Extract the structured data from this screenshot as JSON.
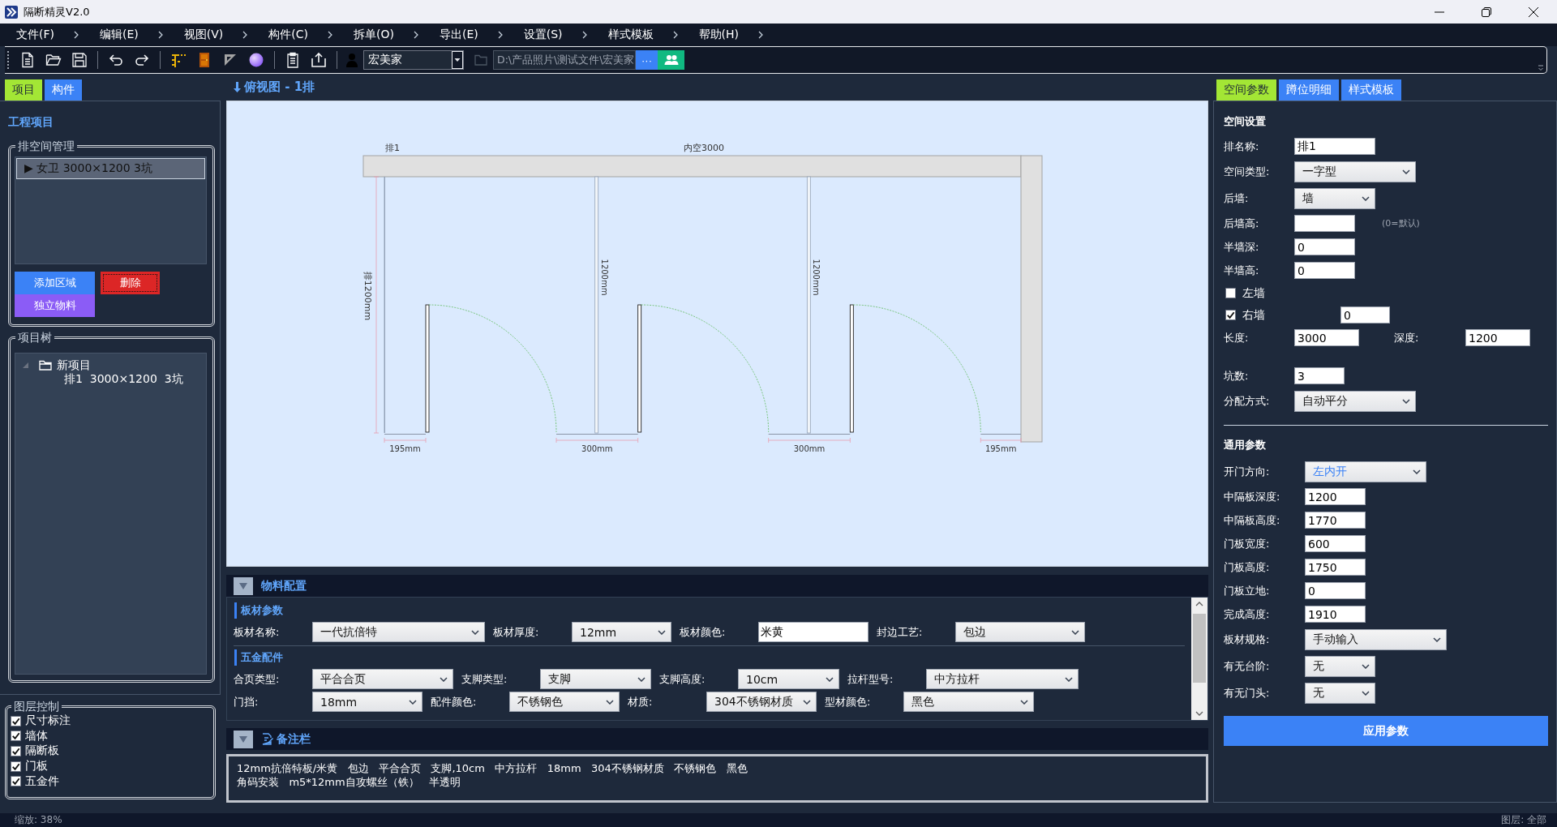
{
  "window": {
    "title": "隔断精灵V2.0"
  },
  "menu": [
    "文件(F)",
    "编辑(E)",
    "视图(V)",
    "构件(C)",
    "拆单(O)",
    "导出(E)",
    "设置(S)",
    "样式模板",
    "帮助(H)"
  ],
  "toolbar": {
    "user": "宏美家",
    "path": "D:\\产品照片\\测试文件\\宏美家",
    "more_button": "···"
  },
  "left_panel": {
    "tabs": [
      {
        "label": "项目",
        "selected": true
      },
      {
        "label": "构件",
        "selected": false
      }
    ],
    "heading": "工程项目",
    "space_group": {
      "title": "排空间管理",
      "items": [
        {
          "label": "▶ 女卫  3000×1200 3坑",
          "selected": true
        }
      ],
      "buttons": [
        {
          "label": "添加区域",
          "kind": "add",
          "focused": false
        },
        {
          "label": "删除",
          "kind": "delete",
          "focused": true
        },
        {
          "label": "独立物料",
          "kind": "material",
          "focused": false
        }
      ]
    },
    "tree_group": {
      "title": "项目树",
      "tree": [
        {
          "label": "新项目",
          "expanded": true,
          "children": [
            {
              "label": "排1  3000×1200  3坑"
            }
          ]
        }
      ]
    },
    "layers": {
      "title": "图层控制",
      "items": [
        {
          "label": "尺寸标注",
          "checked": true
        },
        {
          "label": "墙体",
          "checked": true
        },
        {
          "label": "隔断板",
          "checked": true
        },
        {
          "label": "门板",
          "checked": true
        },
        {
          "label": "五金件",
          "checked": true
        }
      ]
    }
  },
  "view": {
    "title": "俯视图 - 1排",
    "drawing": {
      "row_label": "排1",
      "span_label": "内空3000",
      "depth_label": "排1200mm",
      "partition_labels": [
        "1200mm",
        "1200mm"
      ],
      "gap_labels": [
        "195mm",
        "300mm",
        "300mm",
        "195mm"
      ]
    }
  },
  "materials": {
    "title": "物料配置",
    "sections": [
      {
        "title": "板材参数",
        "fields": [
          {
            "label": "板材名称:",
            "value": "一代抗倍特",
            "kind": "select"
          },
          {
            "label": "板材厚度:",
            "value": "12mm",
            "kind": "select"
          },
          {
            "label": "板材颜色:",
            "value": "米黄",
            "kind": "input"
          },
          {
            "label": "封边工艺:",
            "value": "包边",
            "kind": "select"
          }
        ]
      },
      {
        "title": "五金配件",
        "fields": [
          {
            "label": "合页类型:",
            "value": "平合合页",
            "kind": "select"
          },
          {
            "label": "支脚类型:",
            "value": "支脚",
            "kind": "select"
          },
          {
            "label": "支脚高度:",
            "value": "10cm",
            "kind": "select"
          },
          {
            "label": "拉杆型号:",
            "value": "中方拉杆",
            "kind": "select"
          },
          {
            "label": "门挡:",
            "value": "18mm",
            "kind": "select"
          },
          {
            "label": "配件颜色:",
            "value": "不锈钢色",
            "kind": "select"
          },
          {
            "label": "材质:",
            "value": "304不锈钢材质",
            "kind": "select"
          },
          {
            "label": "型材颜色:",
            "value": "黑色",
            "kind": "select"
          }
        ]
      }
    ]
  },
  "notes": {
    "title": "备注栏",
    "lines": [
      "12mm抗倍特板/米黄   包边   平合合页   支脚,10cm   中方拉杆   18mm   304不锈钢材质   不锈钢色   黑色",
      "角码安装   m5*12mm自攻螺丝（铁）   半透明"
    ]
  },
  "right_panel": {
    "tabs": [
      {
        "label": "空间参数",
        "selected": true
      },
      {
        "label": "蹲位明细",
        "selected": false
      },
      {
        "label": "样式模板",
        "selected": false
      }
    ],
    "sections": [
      {
        "title": "空间设置",
        "rows": [
          {
            "kind": "input",
            "label": "排名称:",
            "value": "排1"
          },
          {
            "kind": "select",
            "label": "空间类型:",
            "value": "一字型",
            "highlighted": false
          },
          {
            "kind": "select",
            "label": "后墙:",
            "value": "墙",
            "highlighted": false
          },
          {
            "kind": "input",
            "label": "后墙高:",
            "note": "(0=默认)"
          },
          {
            "kind": "input",
            "label": "半墙深:",
            "value": "0"
          },
          {
            "kind": "input",
            "label": "半墙高:",
            "value": "0"
          },
          {
            "kind": "checkbox",
            "label": "左墙",
            "checked": false
          },
          {
            "kind": "checkbox",
            "label": "右墙",
            "checked": true,
            "value": "0"
          },
          {
            "kind": "pair",
            "label": "长度:",
            "value": "3000",
            "label2": "深度:",
            "value2": "1200"
          },
          {
            "kind": "input",
            "label": "坑数:",
            "value": "3"
          },
          {
            "kind": "select",
            "label": "分配方式:",
            "value": "自动平分",
            "highlighted": false
          }
        ]
      },
      {
        "title": "通用参数",
        "rows": [
          {
            "kind": "select",
            "label": "开门方向:",
            "value": "左内开",
            "highlighted": true
          },
          {
            "kind": "input",
            "label": "中隔板深度:",
            "value": "1200"
          },
          {
            "kind": "input",
            "label": "中隔板高度:",
            "value": "1770"
          },
          {
            "kind": "input",
            "label": "门板宽度:",
            "value": "600"
          },
          {
            "kind": "input",
            "label": "门板高度:",
            "value": "1750"
          },
          {
            "kind": "input",
            "label": "门板立地:",
            "value": "0"
          },
          {
            "kind": "input",
            "label": "完成高度:",
            "value": "1910"
          },
          {
            "kind": "select",
            "label": "板材规格:",
            "value": "手动输入",
            "highlighted": false
          },
          {
            "kind": "select",
            "label": "有无台阶:",
            "value": "无",
            "highlighted": false
          },
          {
            "kind": "select",
            "label": "有无门头:",
            "value": "无",
            "highlighted": false
          }
        ]
      }
    ],
    "apply_button": "应用参数"
  },
  "status_bar": {
    "zoom": "缩放: 38%",
    "layer": "图层: 全部"
  }
}
